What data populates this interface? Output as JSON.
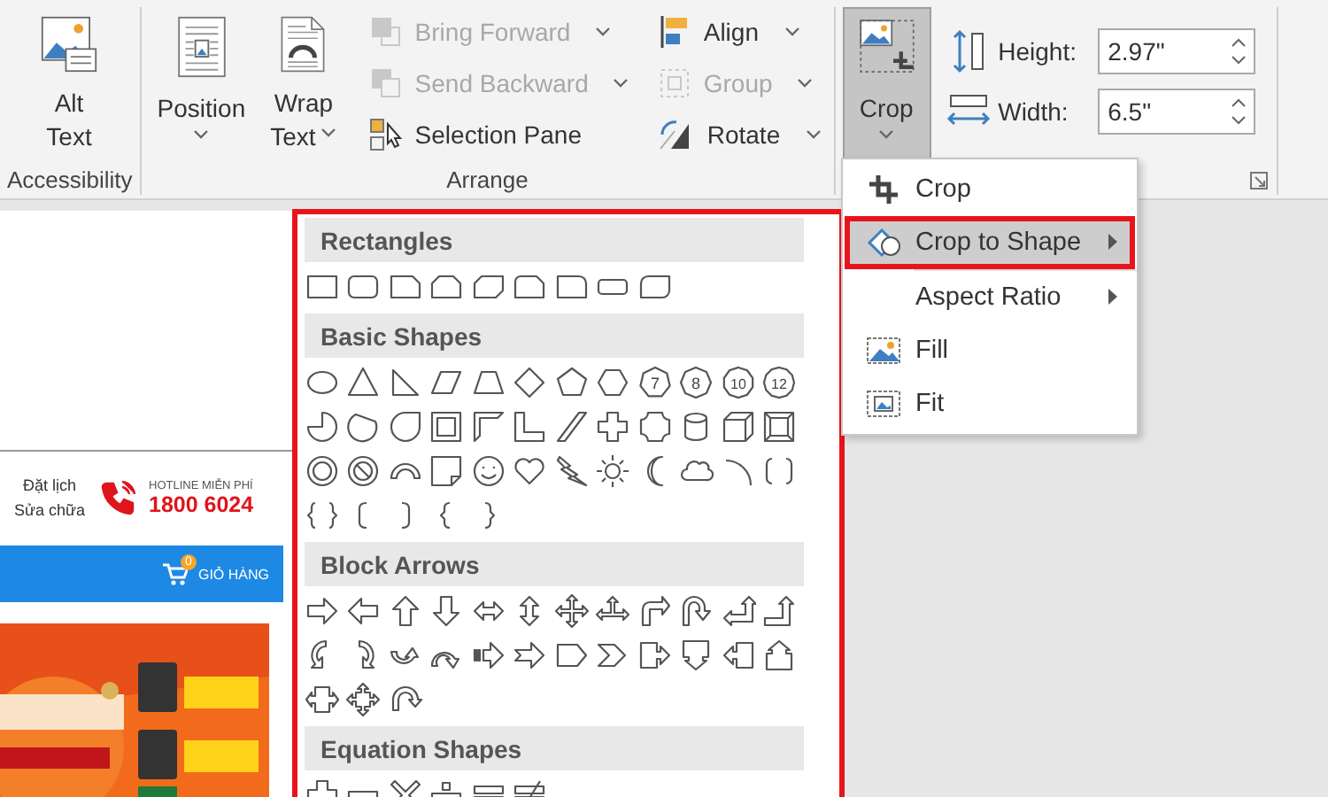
{
  "ribbon": {
    "groups": [
      {
        "label": "Accessibility",
        "items": [
          {
            "kind": "large",
            "lines": [
              "Alt",
              "Text"
            ],
            "dropdown": false,
            "pressed": false
          }
        ]
      },
      {
        "label": "Arrange",
        "items": [
          {
            "kind": "large",
            "lines": [
              "Position"
            ],
            "dropdown": true,
            "pressed": false
          },
          {
            "kind": "large",
            "lines": [
              "Wrap",
              "Text"
            ],
            "dropdown": true,
            "pressed": false
          },
          {
            "kind": "column",
            "items": [
              {
                "label": "Bring Forward",
                "disabled": true,
                "dropdown": true
              },
              {
                "label": "Send Backward",
                "disabled": true,
                "dropdown": true
              },
              {
                "label": "Selection Pane",
                "disabled": false,
                "dropdown": false
              }
            ]
          },
          {
            "kind": "column",
            "items": [
              {
                "label": "Align",
                "disabled": false,
                "dropdown": true
              },
              {
                "label": "Group",
                "disabled": true,
                "dropdown": true
              },
              {
                "label": "Rotate",
                "disabled": false,
                "dropdown": true
              }
            ]
          }
        ]
      },
      {
        "launcher": true,
        "items": [
          {
            "kind": "large",
            "lines": [
              "Crop"
            ],
            "dropdown": true,
            "pressed": true
          },
          {
            "kind": "fields",
            "items": [
              {
                "label": "Height:",
                "value": "2.97\""
              },
              {
                "label": "Width:",
                "value": "6.5\""
              }
            ]
          }
        ]
      }
    ]
  },
  "crop_menu": {
    "items": [
      {
        "kind": "item",
        "label": "Crop",
        "submenu": false,
        "selected": false,
        "highlighted": false
      },
      {
        "kind": "item",
        "label": "Crop to Shape",
        "submenu": true,
        "selected": true,
        "highlighted": true
      },
      {
        "kind": "separator"
      },
      {
        "kind": "item",
        "label": "Aspect Ratio",
        "submenu": true,
        "selected": false,
        "highlighted": false
      },
      {
        "kind": "item",
        "label": "Fill",
        "submenu": false,
        "selected": false,
        "highlighted": false
      },
      {
        "kind": "item",
        "label": "Fit",
        "submenu": false,
        "selected": false,
        "highlighted": false
      }
    ]
  },
  "shape_gallery": {
    "highlighted": true,
    "sections": [
      {
        "title": "Rectangles",
        "shapes": [
          {
            "kind": "rectangle"
          },
          {
            "kind": "rounded-rectangle"
          },
          {
            "kind": "snip-corner-rectangle"
          },
          {
            "kind": "snip-same-side-rectangle"
          },
          {
            "kind": "snip-diagonal-rectangle"
          },
          {
            "kind": "snip-round-rectangle"
          },
          {
            "kind": "round-corner-rectangle"
          },
          {
            "kind": "flat-rounded-rectangle"
          },
          {
            "kind": "round-diagonal-rectangle"
          }
        ]
      },
      {
        "title": "Basic Shapes",
        "shapes": [
          {
            "kind": "oval"
          },
          {
            "kind": "triangle"
          },
          {
            "kind": "right-triangle"
          },
          {
            "kind": "parallelogram"
          },
          {
            "kind": "trapezoid"
          },
          {
            "kind": "diamond"
          },
          {
            "kind": "pentagon"
          },
          {
            "kind": "hexagon"
          },
          {
            "kind": "heptagon",
            "label": "7"
          },
          {
            "kind": "octagon",
            "label": "8"
          },
          {
            "kind": "decagon",
            "label": "10"
          },
          {
            "kind": "dodecagon",
            "label": "12"
          },
          {
            "kind": "partial-circle"
          },
          {
            "kind": "chord"
          },
          {
            "kind": "teardrop"
          },
          {
            "kind": "frame"
          },
          {
            "kind": "half-frame"
          },
          {
            "kind": "l-shape"
          },
          {
            "kind": "diagonal-stripe"
          },
          {
            "kind": "cross"
          },
          {
            "kind": "plaque"
          },
          {
            "kind": "can"
          },
          {
            "kind": "cube"
          },
          {
            "kind": "bevel"
          },
          {
            "kind": "donut"
          },
          {
            "kind": "no-symbol"
          },
          {
            "kind": "block-arc"
          },
          {
            "kind": "folded-corner"
          },
          {
            "kind": "smiley-face"
          },
          {
            "kind": "heart"
          },
          {
            "kind": "lightning-bolt"
          },
          {
            "kind": "sun"
          },
          {
            "kind": "moon"
          },
          {
            "kind": "cloud"
          },
          {
            "kind": "arc"
          },
          {
            "kind": "double-bracket"
          },
          {
            "kind": "double-brace"
          },
          {
            "kind": "left-bracket"
          },
          {
            "kind": "right-bracket"
          },
          {
            "kind": "left-brace"
          },
          {
            "kind": "right-brace"
          }
        ]
      },
      {
        "title": "Block Arrows",
        "shapes": [
          {
            "kind": "right-arrow"
          },
          {
            "kind": "left-arrow"
          },
          {
            "kind": "up-arrow"
          },
          {
            "kind": "down-arrow"
          },
          {
            "kind": "left-right-arrow"
          },
          {
            "kind": "up-down-arrow"
          },
          {
            "kind": "quad-arrow"
          },
          {
            "kind": "left-right-up-arrow"
          },
          {
            "kind": "bent-arrow"
          },
          {
            "kind": "u-turn-arrow"
          },
          {
            "kind": "left-up-arrow"
          },
          {
            "kind": "bent-up-arrow"
          },
          {
            "kind": "curved-right-arrow"
          },
          {
            "kind": "curved-left-arrow"
          },
          {
            "kind": "curved-up-arrow"
          },
          {
            "kind": "curved-down-arrow"
          },
          {
            "kind": "striped-right-arrow"
          },
          {
            "kind": "notched-right-arrow"
          },
          {
            "kind": "pentagon-arrow"
          },
          {
            "kind": "chevron-arrow"
          },
          {
            "kind": "right-arrow-callout"
          },
          {
            "kind": "down-arrow-callout"
          },
          {
            "kind": "left-arrow-callout"
          },
          {
            "kind": "up-arrow-callout"
          },
          {
            "kind": "left-right-arrow-callout"
          },
          {
            "kind": "quad-arrow-callout"
          },
          {
            "kind": "circular-arrow"
          }
        ]
      },
      {
        "title": "Equation Shapes",
        "shapes": [
          {
            "kind": "plus-sign"
          },
          {
            "kind": "minus-sign"
          },
          {
            "kind": "multiply-sign"
          },
          {
            "kind": "division-sign"
          },
          {
            "kind": "equal-sign"
          },
          {
            "kind": "not-equal-sign"
          }
        ]
      }
    ]
  },
  "web_page": {
    "booking": "Đặt lịch Sửa chữa",
    "hotline_label": "HOTLINE MIỄN PHÍ",
    "hotline_number": "1800 6024",
    "cart_count": "0",
    "cart_label": "GIỎ HÀNG"
  }
}
